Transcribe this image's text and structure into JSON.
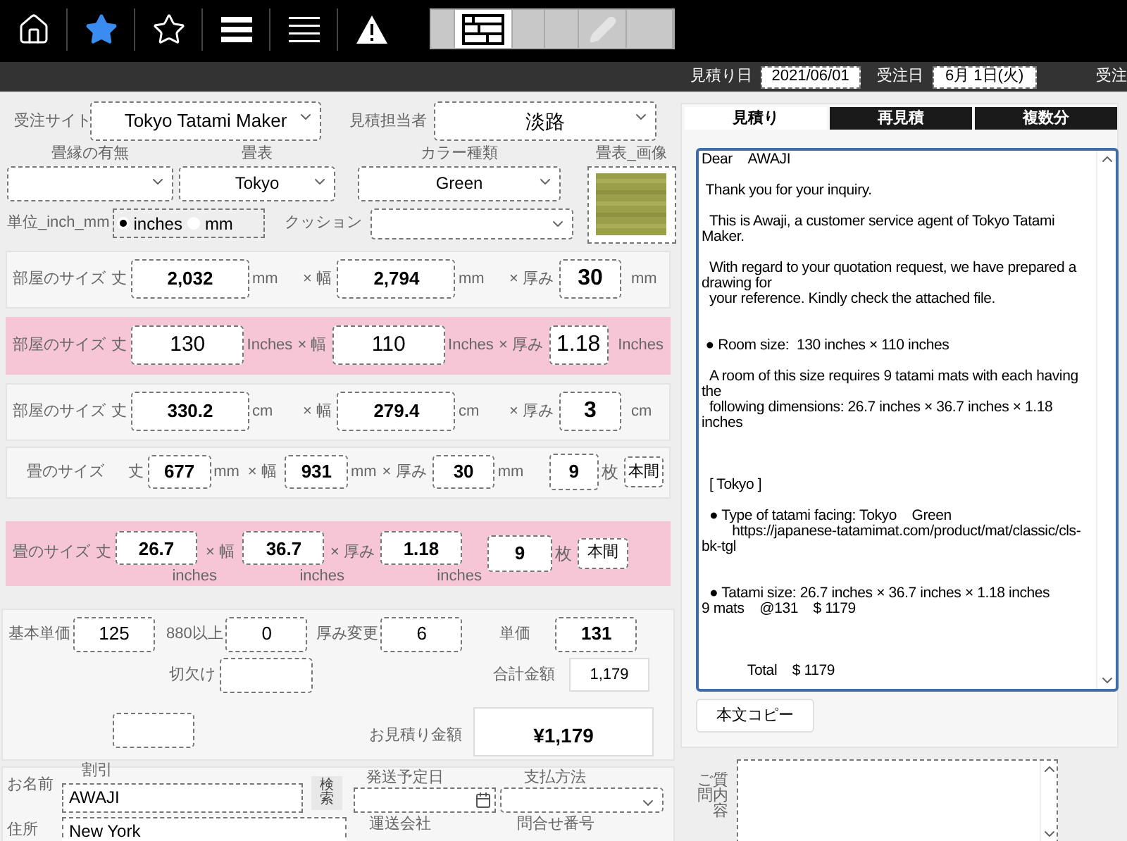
{
  "toolbar": {
    "icons": [
      {
        "kind": "home",
        "selected": false
      },
      {
        "kind": "star",
        "selected": true
      },
      {
        "kind": "star",
        "selected": false
      },
      {
        "kind": "bars",
        "selected": false
      },
      {
        "kind": "lines",
        "selected": false
      },
      {
        "kind": "warning",
        "selected": false
      }
    ],
    "segments": [
      {
        "kind": "blank",
        "selected": false
      },
      {
        "kind": "grid",
        "selected": true
      },
      {
        "kind": "blank",
        "selected": false
      },
      {
        "kind": "blank",
        "selected": false
      },
      {
        "kind": "pencil",
        "selected": false
      },
      {
        "kind": "blank",
        "selected": false
      }
    ]
  },
  "date_bar": [
    {
      "label": "見積り日",
      "value": "2021/06/01"
    },
    {
      "label": "受注日",
      "value": "6月 1日(火)"
    },
    {
      "label": "受注"
    }
  ],
  "header_fields": [
    {
      "label": "受注サイト",
      "value": "Tokyo Tatami Maker"
    },
    {
      "label": "見積担当者",
      "value": "淡路"
    }
  ],
  "selects": [
    {
      "label": "畳縁の有無"
    },
    {
      "label": "畳表",
      "value": "Tokyo"
    },
    {
      "label": "カラー種類",
      "value": "Green"
    }
  ],
  "image_label": "畳表_画像",
  "unit": {
    "label": "単位_inch_mm",
    "options": [
      {
        "label": "inches",
        "selected": true
      },
      {
        "label": "mm",
        "selected": false
      }
    ]
  },
  "cushion": {
    "label": "クッション"
  },
  "room_rows": [
    {
      "highlight": false,
      "title": "部屋のサイズ",
      "length_label": "丈",
      "width_label": "× 幅",
      "thickness_label": "× 厚み",
      "fields": [
        {
          "value": "2,032",
          "unit": "mm"
        },
        {
          "value": "2,794",
          "unit": "mm"
        },
        {
          "value": "30",
          "unit": "mm"
        }
      ]
    },
    {
      "highlight": true,
      "title": "部屋のサイズ",
      "length_label": "丈",
      "width_label": "× 幅",
      "thickness_label": "× 厚み",
      "fields": [
        {
          "value": "130",
          "unit": "Inches"
        },
        {
          "value": "110",
          "unit": "Inches"
        },
        {
          "value": "1.18",
          "unit": "Inches"
        }
      ]
    },
    {
      "highlight": false,
      "title": "部屋のサイズ",
      "length_label": "丈",
      "width_label": "× 幅",
      "thickness_label": "× 厚み",
      "fields": [
        {
          "value": "330.2",
          "unit": "cm"
        },
        {
          "value": "279.4",
          "unit": "cm"
        },
        {
          "value": "3",
          "unit": "cm"
        }
      ]
    }
  ],
  "tatami_rows": [
    {
      "highlight": false,
      "title": "畳のサイズ",
      "length_label": "丈",
      "width_label": "× 幅",
      "thickness_label": "× 厚み",
      "fields": [
        {
          "value": "677",
          "unit": "mm"
        },
        {
          "value": "931",
          "unit": "mm"
        },
        {
          "value": "30",
          "unit": "mm"
        }
      ],
      "count": "9",
      "count_unit": "枚",
      "button": "本間"
    },
    {
      "highlight": true,
      "title": "畳のサイズ",
      "length_label": "丈",
      "width_label": "× 幅",
      "thickness_label": "× 厚み",
      "fields": [
        {
          "value": "26.7",
          "unit": "inches"
        },
        {
          "value": "36.7",
          "unit": "inches"
        },
        {
          "value": "1.18",
          "unit": "inches"
        }
      ],
      "count": "9",
      "count_unit": "枚",
      "button": "本間"
    }
  ],
  "pricing": {
    "fields": [
      {
        "label": "基本単価",
        "value": "125"
      },
      {
        "label": "880以上",
        "value": "0"
      },
      {
        "label": "厚み変更",
        "value": "6"
      },
      {
        "label": "単価",
        "value": "131"
      }
    ],
    "notch": {
      "label": "切欠け"
    },
    "subtotal": {
      "label": "合計金額",
      "value": "1,179"
    },
    "quote": {
      "label": "お見積り金額",
      "value": "¥1,179"
    }
  },
  "customer": {
    "discount_label": "割引",
    "name_label": "お名前",
    "name": "AWAJI",
    "search_button": "検索",
    "address_label": "住所",
    "address": "New York",
    "ship_date_label": "発送予定日",
    "payment_label": "支払方法",
    "carrier_label": "運送会社",
    "tracking_label": "問合せ番号"
  },
  "tabs": [
    {
      "label": "見積り",
      "selected": true
    },
    {
      "label": "再見積",
      "selected": false
    },
    {
      "label": "複数分",
      "selected": false
    }
  ],
  "message": "Dear　AWAJI\n\n Thank you for your inquiry.\n\n  This is Awaji, a customer service agent of Tokyo Tatami Maker.\n\n  With regard to your quotation request, we have prepared a drawing for\n  your reference. Kindly check the attached file.\n\n\n ● Room size:  130 inches × 110 inches\n\n  A room of this size requires 9 tatami mats with each having the\n  following dimensions: 26.7 inches × 36.7 inches × 1.18 inches\n\n\n\n  [ Tokyo ]\n\n  ● Type of tatami facing: Tokyo　Green\n　　https://japanese-tatamimat.com/product/mat/classic/cls-bk-tgl\n\n\n  ● Tatami size: 26.7 inches × 36.7 inches × 1.18 inches\n9 mats　@131　$ 1179\n\n\n\n　　　Total　$ 1179",
  "copy_button": "本文コピー",
  "question_label": "ご質問内容"
}
